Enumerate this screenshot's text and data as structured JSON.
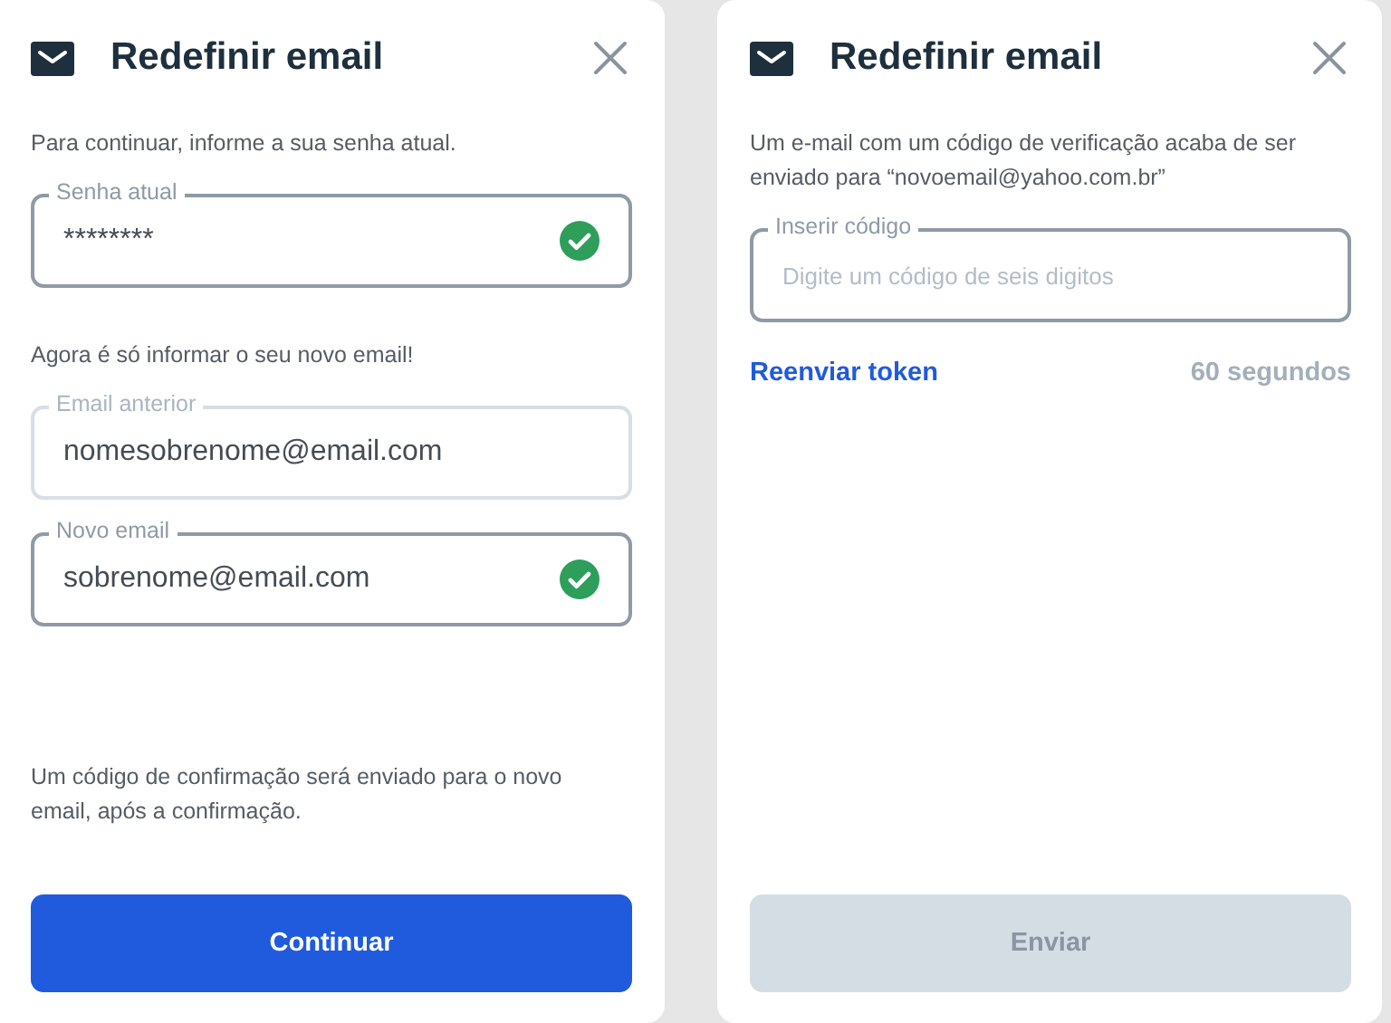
{
  "panels": [
    {
      "title": "Redefinir email",
      "blocks": [
        {
          "kind": "text",
          "text": "Para continuar, informe a sua senha atual."
        },
        {
          "kind": "field",
          "label": "Senha atual",
          "value": "********",
          "disabled": false,
          "valid": true
        },
        {
          "kind": "text",
          "text": "Agora é só informar o seu novo email!"
        },
        {
          "kind": "field",
          "label": "Email anterior",
          "value": "nomesobrenome@email.com",
          "disabled": true,
          "valid": false
        },
        {
          "kind": "field",
          "label": "Novo email",
          "value": "sobrenome@email.com",
          "disabled": false,
          "valid": true
        }
      ],
      "note": "Um código de confirmação será enviado para o novo email, após a confirmação.",
      "button": {
        "label": "Continuar",
        "disabled": false
      }
    },
    {
      "title": "Redefinir email",
      "blocks": [
        {
          "kind": "text",
          "text": "Um e-mail com um código de verificação acaba de ser enviado para “novoemail@yahoo.com.br”"
        },
        {
          "kind": "field",
          "label": "Inserir código",
          "placeholder": "Digite um código de seis digitos",
          "disabled": false,
          "valid": false
        },
        {
          "kind": "resend",
          "link": "Reenviar token",
          "countdown": "60 segundos"
        }
      ],
      "button": {
        "label": "Enviar",
        "disabled": true
      }
    }
  ]
}
